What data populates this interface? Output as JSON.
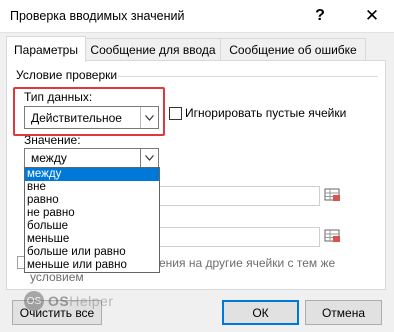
{
  "window": {
    "title": "Проверка вводимых значений",
    "help_glyph": "?",
    "close_glyph": "✕"
  },
  "tabs": [
    {
      "label": "Параметры",
      "active": true
    },
    {
      "label": "Сообщение для ввода",
      "active": false
    },
    {
      "label": "Сообщение об ошибке",
      "active": false
    }
  ],
  "settings": {
    "group_label": "Условие проверки",
    "data_type_label": "Тип данных:",
    "data_type_value": "Действительное",
    "ignore_blank_label": "Игнорировать пустые ячейки",
    "value_label": "Значение:",
    "value_selected": "между",
    "value_options": [
      "между",
      "вне",
      "равно",
      "не равно",
      "больше",
      "меньше",
      "больше или равно",
      "меньше или равно"
    ],
    "apply_text_line1": "ения на другие ячейки с тем же",
    "apply_text_line2": "условием"
  },
  "buttons": {
    "clear_all": "Очистить все",
    "ok": "ОК",
    "cancel": "Отмена"
  },
  "watermark": {
    "logo": "OS",
    "text_bold": "OS",
    "text_rest": "Helper"
  },
  "colors": {
    "highlight": "#e0393d",
    "selection": "#0078d7"
  }
}
